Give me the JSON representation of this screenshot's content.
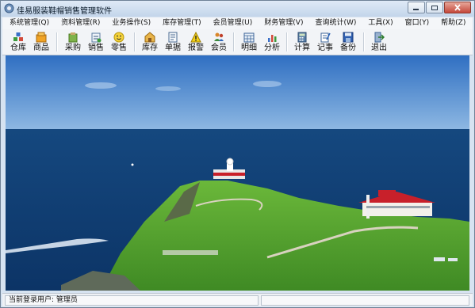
{
  "window": {
    "title": "佳易服装鞋帽销售管理软件"
  },
  "menubar": {
    "items": [
      {
        "label": "系统管理(Q)"
      },
      {
        "label": "资料管理(R)"
      },
      {
        "label": "业务操作(S)"
      },
      {
        "label": "库存管理(T)"
      },
      {
        "label": "会员管理(U)"
      },
      {
        "label": "财务管理(V)"
      },
      {
        "label": "查询统计(W)"
      },
      {
        "label": "工具(X)"
      },
      {
        "label": "窗口(Y)"
      },
      {
        "label": "帮助(Z)"
      }
    ]
  },
  "toolbar": {
    "buttons": [
      {
        "label": "仓库",
        "icon": "warehouse-icon"
      },
      {
        "label": "商品",
        "icon": "goods-icon"
      },
      {
        "label": "采购",
        "icon": "purchase-icon"
      },
      {
        "label": "销售",
        "icon": "sales-icon"
      },
      {
        "label": "零售",
        "icon": "retail-icon"
      },
      {
        "label": "库存",
        "icon": "inventory-icon"
      },
      {
        "label": "单据",
        "icon": "document-icon"
      },
      {
        "label": "报警",
        "icon": "warning-icon"
      },
      {
        "label": "会员",
        "icon": "members-icon"
      },
      {
        "label": "明细",
        "icon": "details-icon"
      },
      {
        "label": "分析",
        "icon": "analysis-icon"
      },
      {
        "label": "计算",
        "icon": "calculator-icon"
      },
      {
        "label": "记事",
        "icon": "notepad-icon"
      },
      {
        "label": "备份",
        "icon": "backup-icon"
      },
      {
        "label": "退出",
        "icon": "exit-icon"
      }
    ]
  },
  "status": {
    "login_label": "当前登录用户:",
    "user": "管理员"
  },
  "colors": {
    "title_bar": "#c9daee",
    "sea": "#0f3f7a",
    "sky": "#4f8ed0",
    "grass": "#4f9a2a",
    "roof": "#c8202a"
  }
}
